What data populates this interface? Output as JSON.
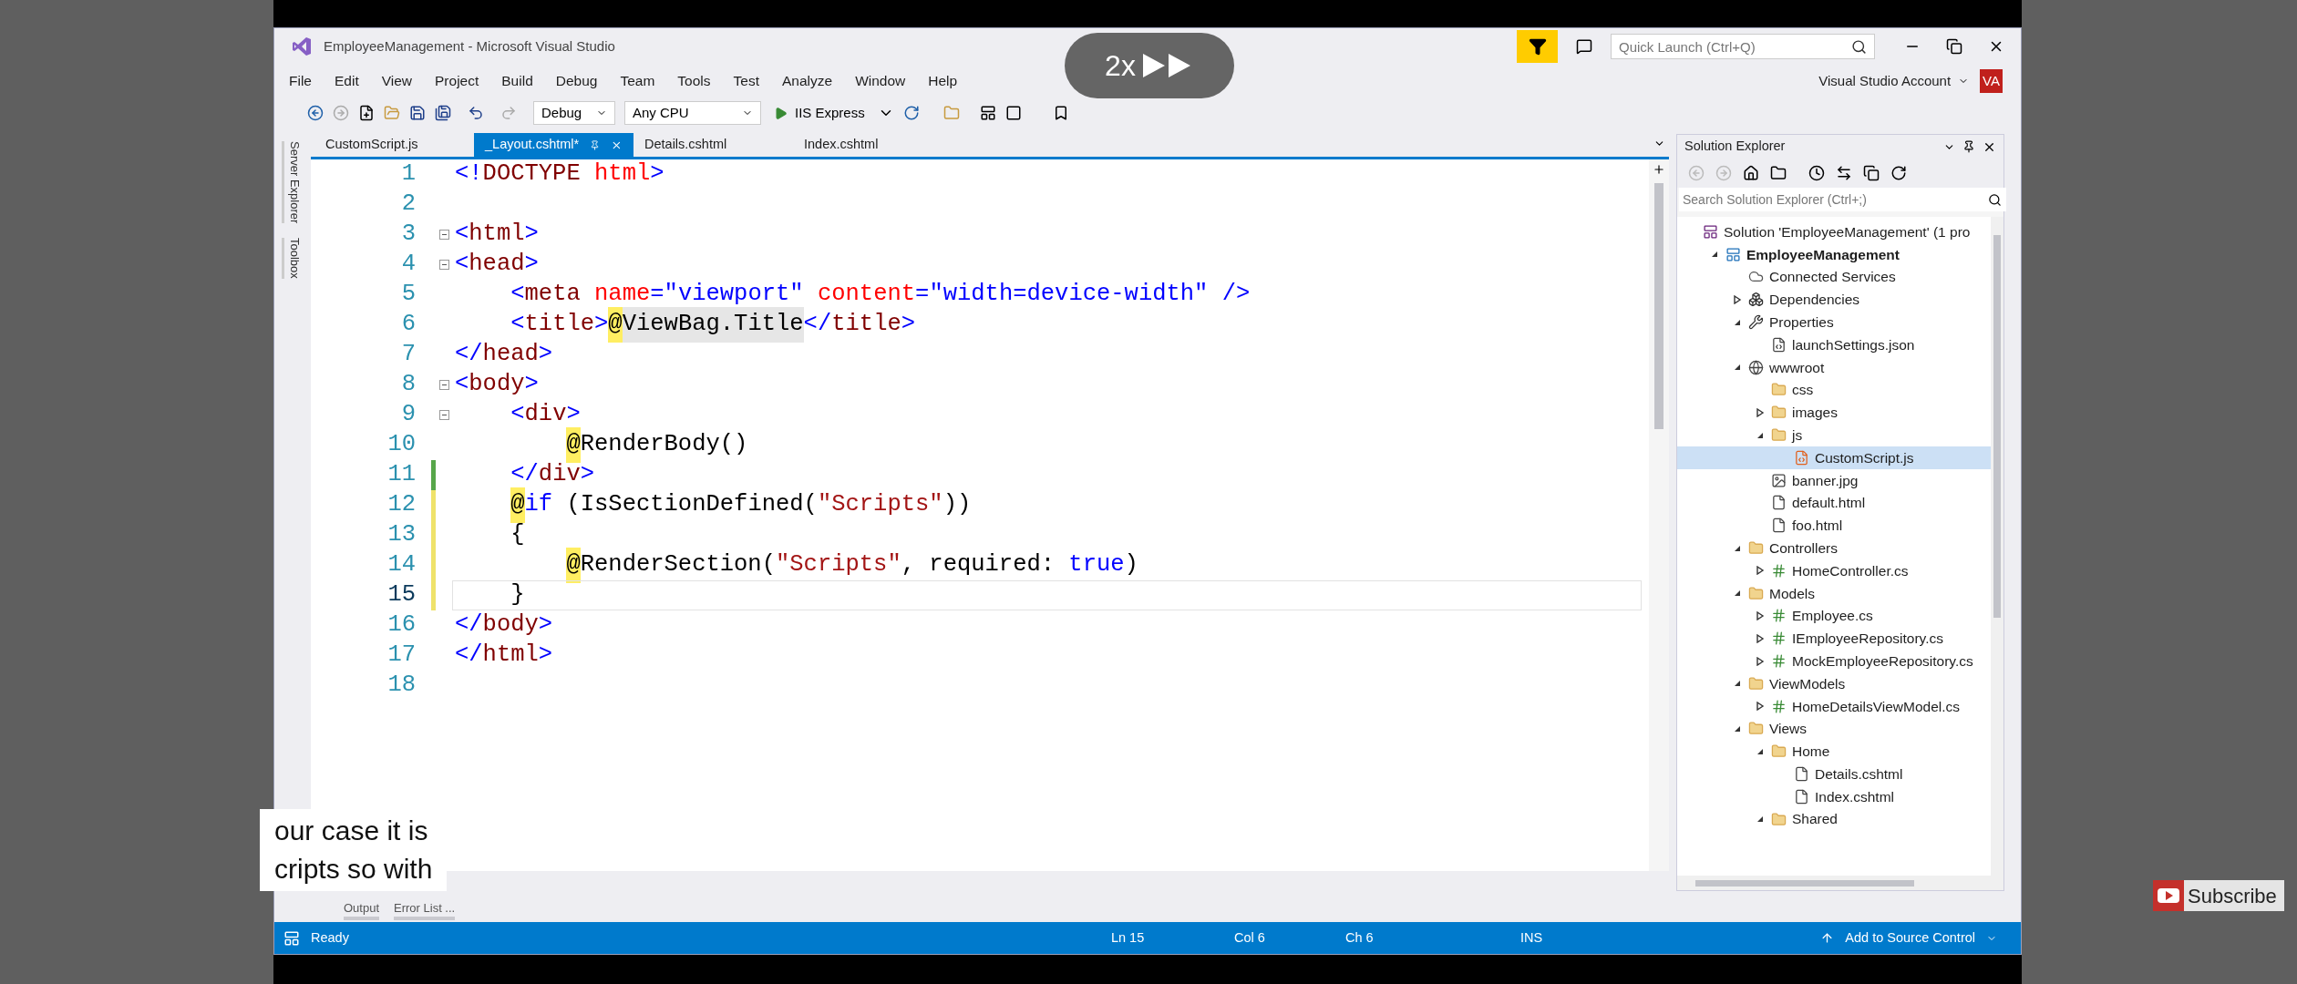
{
  "overlay": {
    "speed": "2x"
  },
  "caption": {
    "lines": [
      "our case it is",
      "cripts so with"
    ]
  },
  "subscribe": {
    "label": "Subscribe"
  },
  "window": {
    "title": "EmployeeManagement - Microsoft Visual Studio",
    "quick_launch": {
      "placeholder": "Quick Launch (Ctrl+Q)"
    },
    "account": "Visual Studio Account",
    "avatar": "VA"
  },
  "menu": [
    "File",
    "Edit",
    "View",
    "Project",
    "Build",
    "Debug",
    "Team",
    "Tools",
    "Test",
    "Analyze",
    "Window",
    "Help"
  ],
  "toolbar": {
    "configuration": "Debug",
    "platform": "Any CPU",
    "run": "IIS Express"
  },
  "side_tabs": [
    "Server Explorer",
    "Toolbox"
  ],
  "doc_tabs": [
    {
      "label": "CustomScript.js",
      "selected": false
    },
    {
      "label": "_Layout.cshtml*",
      "selected": true
    },
    {
      "label": "Details.cshtml",
      "selected": false
    },
    {
      "label": "Index.cshtml",
      "selected": false
    }
  ],
  "editor": {
    "lines": [
      {
        "number": "1",
        "fold": false,
        "current": false,
        "tokens": [
          {
            "kind": "delim",
            "text": "<!"
          },
          {
            "kind": "tag",
            "text": "DOCTYPE"
          },
          {
            "kind": "attr",
            "text": " html"
          },
          {
            "kind": "delim",
            "text": ">"
          }
        ]
      },
      {
        "number": "2",
        "fold": false,
        "current": false
      },
      {
        "number": "3",
        "fold": true,
        "current": false,
        "tokens": [
          {
            "kind": "delim",
            "text": "<"
          },
          {
            "kind": "tag",
            "text": "html"
          },
          {
            "kind": "delim",
            "text": ">"
          }
        ]
      },
      {
        "number": "4",
        "fold": true,
        "current": false,
        "tokens": [
          {
            "kind": "delim",
            "text": "<"
          },
          {
            "kind": "tag",
            "text": "head"
          },
          {
            "kind": "delim",
            "text": ">"
          }
        ]
      },
      {
        "number": "5",
        "fold": false,
        "current": false,
        "tokens": [
          {
            "kind": "delim",
            "text": "    <"
          },
          {
            "kind": "tag",
            "text": "meta"
          },
          {
            "kind": "attr",
            "text": " name"
          },
          {
            "kind": "delim",
            "text": "="
          },
          {
            "kind": "value",
            "text": "\"viewport\""
          },
          {
            "kind": "attr",
            "text": " content"
          },
          {
            "kind": "delim",
            "text": "="
          },
          {
            "kind": "value",
            "text": "\"width=device-width\""
          },
          {
            "kind": "delim",
            "text": " />"
          }
        ]
      },
      {
        "number": "6",
        "fold": false,
        "current": false,
        "tokens": [
          {
            "kind": "delim",
            "text": "    <"
          },
          {
            "kind": "tag",
            "text": "title"
          },
          {
            "kind": "delim",
            "text": ">"
          },
          {
            "kind": "razor",
            "text": "@"
          },
          {
            "kind": "expr",
            "text": "ViewBag.Title"
          },
          {
            "kind": "delim",
            "text": "</"
          },
          {
            "kind": "tag",
            "text": "title"
          },
          {
            "kind": "delim",
            "text": ">"
          }
        ]
      },
      {
        "number": "7",
        "fold": false,
        "current": false,
        "tokens": [
          {
            "kind": "delim",
            "text": "</"
          },
          {
            "kind": "tag",
            "text": "head"
          },
          {
            "kind": "delim",
            "text": ">"
          }
        ]
      },
      {
        "number": "8",
        "fold": true,
        "current": false,
        "tokens": [
          {
            "kind": "delim",
            "text": "<"
          },
          {
            "kind": "tag",
            "text": "body"
          },
          {
            "kind": "delim",
            "text": ">"
          }
        ]
      },
      {
        "number": "9",
        "fold": true,
        "current": false,
        "tokens": [
          {
            "kind": "delim",
            "text": "    <"
          },
          {
            "kind": "tag",
            "text": "div"
          },
          {
            "kind": "delim",
            "text": ">"
          }
        ]
      },
      {
        "number": "10",
        "fold": false,
        "current": false,
        "tokens": [
          {
            "kind": "razor",
            "text": "        @"
          },
          {
            "kind": "code",
            "text": "RenderBody()"
          }
        ]
      },
      {
        "number": "11",
        "fold": false,
        "current": false,
        "modified": true,
        "saved": true,
        "tokens": [
          {
            "kind": "delim",
            "text": "    </"
          },
          {
            "kind": "tag",
            "text": "div"
          },
          {
            "kind": "delim",
            "text": ">"
          }
        ]
      },
      {
        "number": "12",
        "fold": false,
        "current": false,
        "modified": true,
        "saved": false,
        "tokens": [
          {
            "kind": "razor",
            "text": "    @"
          },
          {
            "kind": "keyword",
            "text": "if"
          },
          {
            "kind": "code",
            "text": " (IsSectionDefined("
          },
          {
            "kind": "string",
            "text": "\"Scripts\""
          },
          {
            "kind": "code",
            "text": "))"
          }
        ]
      },
      {
        "number": "13",
        "fold": false,
        "current": false,
        "modified": true,
        "saved": false,
        "tokens": [
          {
            "kind": "code",
            "text": "    {"
          }
        ]
      },
      {
        "number": "14",
        "fold": false,
        "current": false,
        "modified": true,
        "saved": false,
        "tokens": [
          {
            "kind": "razor",
            "text": "        @"
          },
          {
            "kind": "code",
            "text": "RenderSection("
          },
          {
            "kind": "string",
            "text": "\"Scripts\""
          },
          {
            "kind": "code",
            "text": ", required: "
          },
          {
            "kind": "keyword",
            "text": "true"
          },
          {
            "kind": "code",
            "text": ")"
          }
        ]
      },
      {
        "number": "15",
        "fold": false,
        "current": true,
        "modified": true,
        "saved": false,
        "tokens": [
          {
            "kind": "code",
            "text": "    }"
          }
        ]
      },
      {
        "number": "16",
        "fold": false,
        "current": false,
        "tokens": [
          {
            "kind": "delim",
            "text": "</"
          },
          {
            "kind": "tag",
            "text": "body"
          },
          {
            "kind": "delim",
            "text": ">"
          }
        ]
      },
      {
        "number": "17",
        "fold": false,
        "current": false,
        "tokens": [
          {
            "kind": "delim",
            "text": "</"
          },
          {
            "kind": "tag",
            "text": "html"
          },
          {
            "kind": "delim",
            "text": ">"
          }
        ]
      },
      {
        "number": "18",
        "fold": false,
        "current": false
      }
    ]
  },
  "bottom_tabs": [
    "Output",
    "Error List ..."
  ],
  "solution_explorer": {
    "title": "Solution Explorer",
    "search": {
      "placeholder": "Search Solution Explorer (Ctrl+;)"
    },
    "tree": [
      {
        "label": "Solution 'EmployeeManagement' (1 pro",
        "kind": "solution",
        "selected": false,
        "children": [
          {
            "label": "EmployeeManagement",
            "kind": "project",
            "expanded": true,
            "selected": false,
            "children": [
              {
                "label": "Connected Services",
                "kind": "connected",
                "selected": false
              },
              {
                "label": "Dependencies",
                "kind": "dependencies",
                "expanded": false,
                "selected": false
              },
              {
                "label": "Properties",
                "kind": "properties",
                "expanded": true,
                "selected": false,
                "children": [
                  {
                    "label": "launchSettings.json",
                    "kind": "json",
                    "selected": false
                  }
                ]
              },
              {
                "label": "wwwroot",
                "kind": "globe",
                "expanded": true,
                "selected": false,
                "children": [
                  {
                    "label": "css",
                    "kind": "folder",
                    "selected": false
                  },
                  {
                    "label": "images",
                    "kind": "folder",
                    "expanded": false,
                    "selected": false
                  },
                  {
                    "label": "js",
                    "kind": "folder",
                    "expanded": true,
                    "selected": false,
                    "children": [
                      {
                        "label": "CustomScript.js",
                        "kind": "js",
                        "selected": true
                      }
                    ]
                  },
                  {
                    "label": "banner.jpg",
                    "kind": "image",
                    "selected": false
                  },
                  {
                    "label": "default.html",
                    "kind": "html",
                    "selected": false
                  },
                  {
                    "label": "foo.html",
                    "kind": "html",
                    "selected": false
                  }
                ]
              },
              {
                "label": "Controllers",
                "kind": "folder",
                "expanded": true,
                "selected": false,
                "children": [
                  {
                    "label": "HomeController.cs",
                    "kind": "cs",
                    "expanded": false,
                    "selected": false
                  }
                ]
              },
              {
                "label": "Models",
                "kind": "folder",
                "expanded": true,
                "selected": false,
                "children": [
                  {
                    "label": "Employee.cs",
                    "kind": "cs",
                    "expanded": false,
                    "selected": false
                  },
                  {
                    "label": "IEmployeeRepository.cs",
                    "kind": "cs",
                    "expanded": false,
                    "selected": false
                  },
                  {
                    "label": "MockEmployeeRepository.cs",
                    "kind": "cs",
                    "expanded": false,
                    "selected": false
                  }
                ]
              },
              {
                "label": "ViewModels",
                "kind": "folder",
                "expanded": true,
                "selected": false,
                "children": [
                  {
                    "label": "HomeDetailsViewModel.cs",
                    "kind": "cs",
                    "expanded": false,
                    "selected": false
                  }
                ]
              },
              {
                "label": "Views",
                "kind": "folder",
                "expanded": true,
                "selected": false,
                "children": [
                  {
                    "label": "Home",
                    "kind": "folder",
                    "expanded": true,
                    "selected": false,
                    "children": [
                      {
                        "label": "Details.cshtml",
                        "kind": "cshtml",
                        "selected": false
                      },
                      {
                        "label": "Index.cshtml",
                        "kind": "cshtml",
                        "selected": false
                      }
                    ]
                  },
                  {
                    "label": "Shared",
                    "kind": "folder",
                    "expanded": true,
                    "selected": false
                  }
                ]
              }
            ]
          }
        ]
      }
    ]
  },
  "status_bar": {
    "state": "Ready",
    "line": "Ln 15",
    "column": "Col 6",
    "char": "Ch 6",
    "mode": "INS",
    "source_control": "Add to Source Control"
  }
}
